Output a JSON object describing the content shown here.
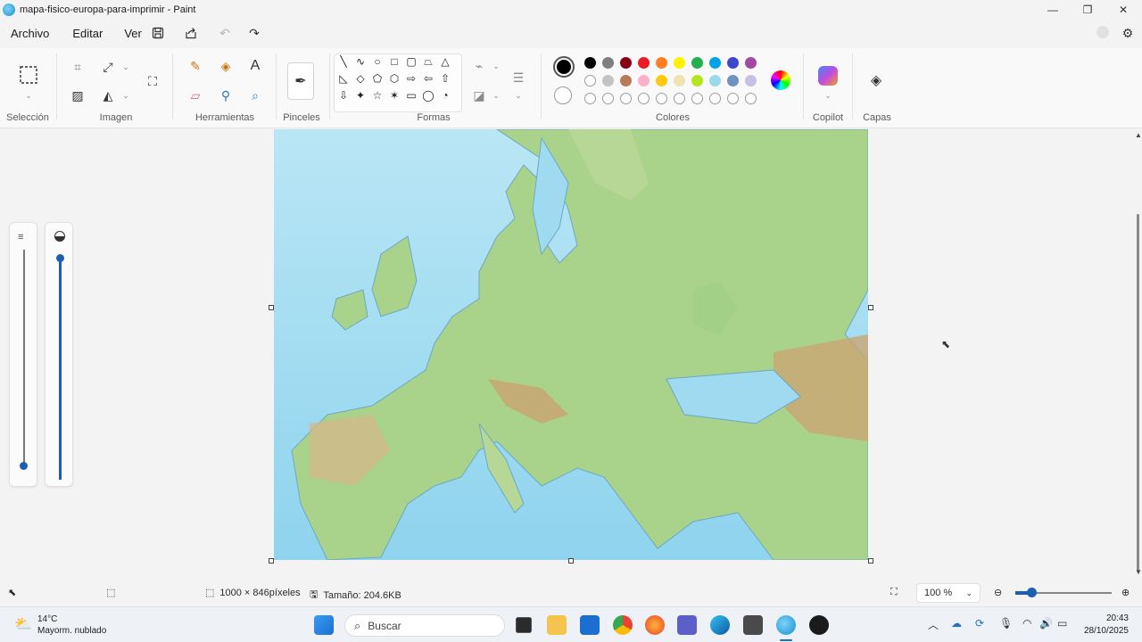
{
  "window": {
    "title": "mapa-fisico-europa-para-imprimir - Paint",
    "controls": {
      "minimize": "—",
      "maximize": "❐",
      "close": "✕"
    }
  },
  "menu": [
    "Archivo",
    "Editar",
    "Ver"
  ],
  "ribbon": {
    "groups": {
      "seleccion": "Selección",
      "imagen": "Imagen",
      "herramientas": "Herramientas",
      "pinceles": "Pinceles",
      "formas": "Formas",
      "colores": "Colores",
      "copilot": "Copilot",
      "capas": "Capas"
    },
    "shape_glyphs": [
      "╲",
      "∿",
      "○",
      "□",
      "▢",
      "⏢",
      "△",
      "◺",
      "◇",
      "⬠",
      "⬡",
      "⇨",
      "⇦",
      "⇧",
      "⇩",
      "✦",
      "☆",
      "✶",
      "▭",
      "◯",
      "◔"
    ],
    "colors_row1": [
      "#000000",
      "#7f7f7f",
      "#880015",
      "#ed1c24",
      "#ff7f27",
      "#fff200",
      "#22b14c",
      "#00a2e8",
      "#3f48cc",
      "#a349a4"
    ],
    "colors_row2": [
      "#ffffff",
      "#c3c3c3",
      "#b97a57",
      "#ffaec9",
      "#ffc90e",
      "#efe4b0",
      "#b5e61d",
      "#99d9ea",
      "#7092be",
      "#c8bfe7"
    ],
    "primary_color": "#000000",
    "secondary_color": "#ffffff"
  },
  "canvas": {
    "image_name": "mapa-fisico-europa-para-imprimir"
  },
  "statusbar": {
    "dimensions": "1000 × 846píxeles",
    "size": "Tamaño: 204.6KB",
    "zoom": "100 %"
  },
  "taskbar": {
    "weather_temp": "14°C",
    "weather_desc": "Mayorm. nublado",
    "search_placeholder": "Buscar",
    "time": "20:43",
    "date": "28/10/2025"
  }
}
